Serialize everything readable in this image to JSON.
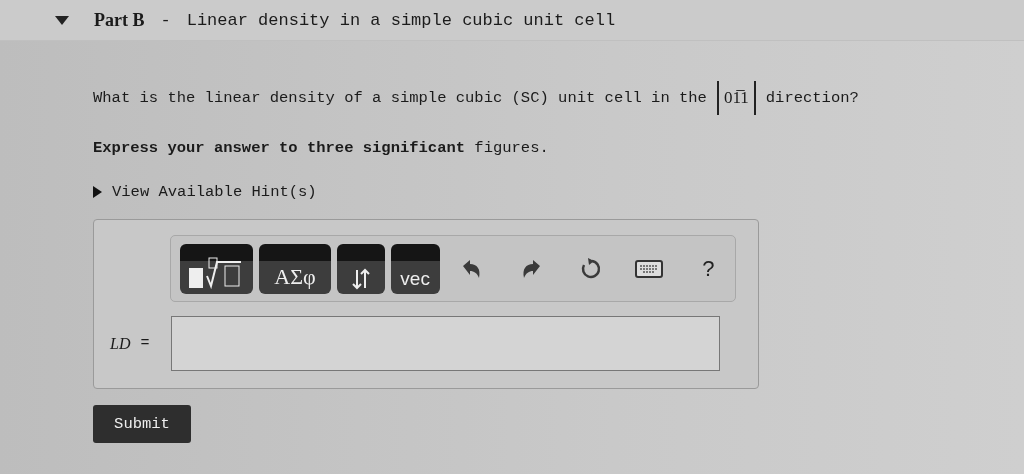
{
  "part": {
    "expanded": true,
    "label": "Part B",
    "separator": "-",
    "title": "Linear density in a simple cubic unit cell"
  },
  "question": {
    "before": "What is the linear density of a simple cubic (SC) unit cell in the",
    "direction": "01̅1",
    "after": "direction?"
  },
  "instruction": "**Express your answer to three significant** figures.",
  "hint": {
    "label": "View Available Hint(s)",
    "expanded": false
  },
  "toolbar": [
    {
      "kind": "template"
    },
    {
      "kind": "text",
      "label": "ΑΣφ"
    },
    {
      "kind": "arrows"
    },
    {
      "kind": "text",
      "label": "vec"
    },
    {
      "kind": "undo"
    },
    {
      "kind": "redo"
    },
    {
      "kind": "reset"
    },
    {
      "kind": "keyboard"
    },
    {
      "kind": "help",
      "label": "?"
    }
  ],
  "answer": {
    "variable": "LD",
    "equals": "="
  },
  "submit": "Submit"
}
